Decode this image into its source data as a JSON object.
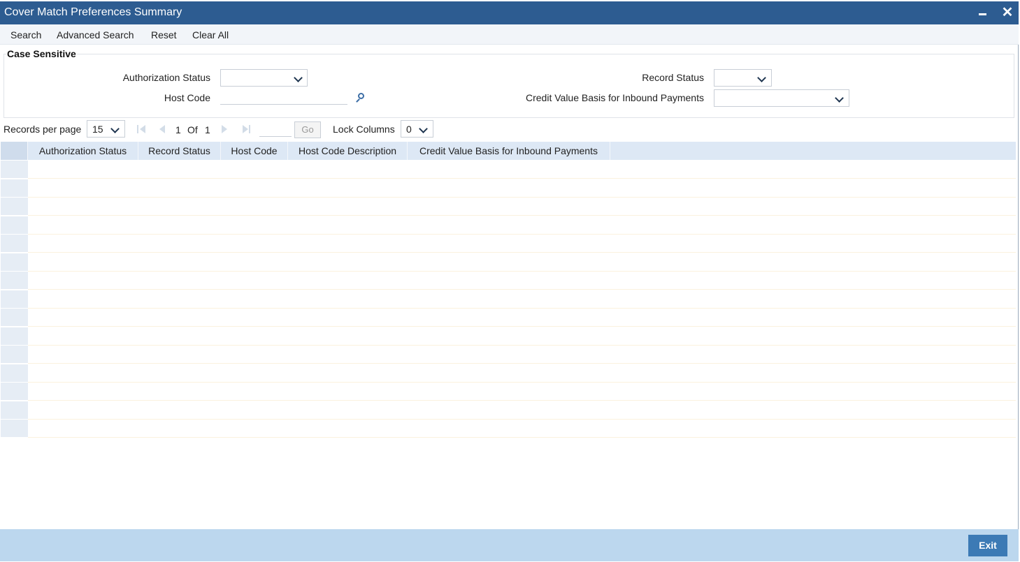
{
  "window": {
    "title": "Cover Match Preferences Summary"
  },
  "toolbar": {
    "search": "Search",
    "advanced_search": "Advanced Search",
    "reset": "Reset",
    "clear_all": "Clear All"
  },
  "criteria": {
    "legend": "Case Sensitive",
    "authorization_status_label": "Authorization Status",
    "authorization_status_value": "",
    "host_code_label": "Host Code",
    "host_code_value": "",
    "record_status_label": "Record Status",
    "record_status_value": "",
    "credit_value_basis_label": "Credit Value Basis for Inbound Payments",
    "credit_value_basis_value": ""
  },
  "pager": {
    "records_per_page_label": "Records per page",
    "records_per_page_value": "15",
    "current_page": "1",
    "of_label": "Of",
    "total_pages": "1",
    "go_label": "Go",
    "lock_columns_label": "Lock Columns",
    "lock_columns_value": "0"
  },
  "grid": {
    "columns": [
      "Authorization Status",
      "Record Status",
      "Host Code",
      "Host Code Description",
      "Credit Value Basis for Inbound Payments"
    ],
    "empty_rows": 15
  },
  "footer": {
    "exit": "Exit"
  },
  "colors": {
    "title_bar": "#2d5c91",
    "grid_header": "#dde8f5",
    "footer": "#bcd7ee",
    "exit_button": "#3c7ab5"
  }
}
